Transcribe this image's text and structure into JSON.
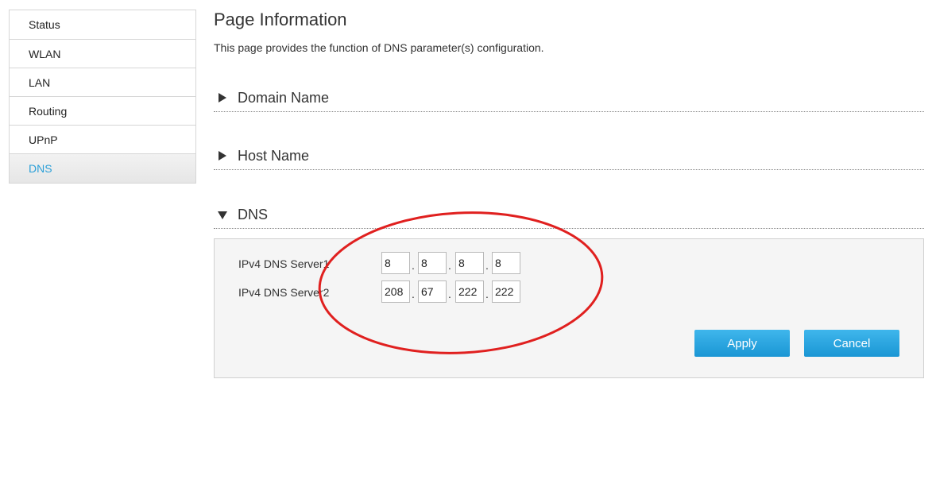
{
  "sidebar": {
    "items": [
      {
        "label": "Status"
      },
      {
        "label": "WLAN"
      },
      {
        "label": "LAN"
      },
      {
        "label": "Routing"
      },
      {
        "label": "UPnP"
      },
      {
        "label": "DNS",
        "active": true
      }
    ]
  },
  "page": {
    "title": "Page Information",
    "description": "This page provides the function of DNS parameter(s) configuration."
  },
  "sections": {
    "domain_name": {
      "label": "Domain Name",
      "expanded": false
    },
    "host_name": {
      "label": "Host Name",
      "expanded": false
    },
    "dns": {
      "label": "DNS",
      "expanded": true
    }
  },
  "dns": {
    "server1": {
      "label": "IPv4 DNS Server1",
      "octets": [
        "8",
        "8",
        "8",
        "8"
      ]
    },
    "server2": {
      "label": "IPv4 DNS Server2",
      "octets": [
        "208",
        "67",
        "222",
        "222"
      ]
    },
    "separator": ".",
    "apply_label": "Apply",
    "cancel_label": "Cancel"
  },
  "colors": {
    "accent": "#2a9fd8",
    "button": "#1a96d4",
    "annotation": "#e0201f"
  }
}
